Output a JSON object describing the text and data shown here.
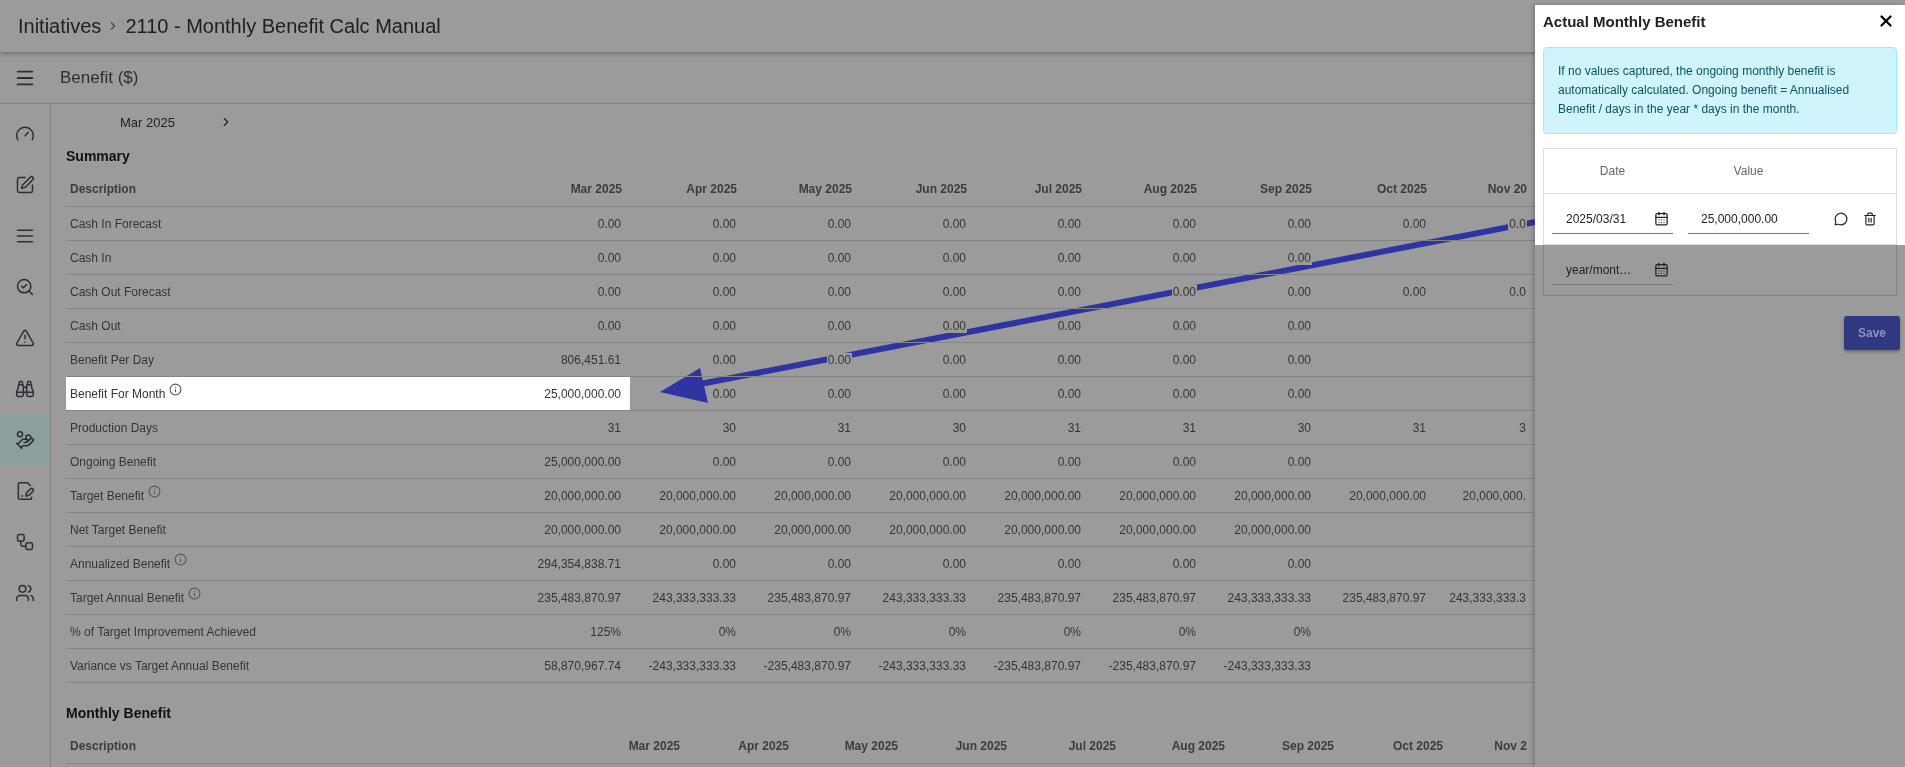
{
  "breadcrumb": {
    "root": "Initiatives",
    "title": "2110 - Monthly Benefit Calc Manual"
  },
  "page_title": "Benefit ($)",
  "sidebar": {
    "items": [
      {
        "kind": "gauge",
        "selected": false
      },
      {
        "kind": "edit",
        "selected": false
      },
      {
        "kind": "list",
        "selected": false
      },
      {
        "kind": "search",
        "selected": false
      },
      {
        "kind": "warning",
        "selected": false
      },
      {
        "kind": "binoculars",
        "selected": false
      },
      {
        "kind": "hand-coins",
        "selected": true
      },
      {
        "kind": "document",
        "selected": false
      },
      {
        "kind": "flow",
        "selected": false
      },
      {
        "kind": "people",
        "selected": false
      }
    ]
  },
  "period": {
    "label": "Mar 2025"
  },
  "summary": {
    "title": "Summary",
    "label_header": "Description",
    "columns": [
      "Mar 2025",
      "Apr 2025",
      "May 2025",
      "Jun 2025",
      "Jul 2025",
      "Aug 2025",
      "Sep 2025",
      "Oct 2025",
      "Nov 20"
    ],
    "rows": [
      {
        "label": "Cash In Forecast",
        "info": false,
        "highlighted": false,
        "cells": [
          "0.00",
          "0.00",
          "0.00",
          "0.00",
          "0.00",
          "0.00",
          "0.00",
          "0.00",
          "0.0"
        ]
      },
      {
        "label": "Cash In",
        "info": false,
        "highlighted": false,
        "cells": [
          "0.00",
          "0.00",
          "0.00",
          "0.00",
          "0.00",
          "0.00",
          "0.00",
          null,
          null
        ]
      },
      {
        "label": "Cash Out Forecast",
        "info": false,
        "highlighted": false,
        "cells": [
          "0.00",
          "0.00",
          "0.00",
          "0.00",
          "0.00",
          "0.00",
          "0.00",
          "0.00",
          "0.0"
        ]
      },
      {
        "label": "Cash Out",
        "info": false,
        "highlighted": false,
        "cells": [
          "0.00",
          "0.00",
          "0.00",
          "0.00",
          "0.00",
          "0.00",
          "0.00",
          null,
          null
        ]
      },
      {
        "label": "Benefit Per Day",
        "info": false,
        "highlighted": false,
        "cells": [
          "806,451.61",
          "0.00",
          "0.00",
          "0.00",
          "0.00",
          "0.00",
          "0.00",
          null,
          null
        ]
      },
      {
        "label": "Benefit For Month",
        "info": true,
        "highlighted": true,
        "cells": [
          "25,000,000.00",
          "0.00",
          "0.00",
          "0.00",
          "0.00",
          "0.00",
          "0.00",
          null,
          null
        ]
      },
      {
        "label": "Production Days",
        "info": false,
        "highlighted": false,
        "cells": [
          "31",
          "30",
          "31",
          "30",
          "31",
          "31",
          "30",
          "31",
          "3"
        ]
      },
      {
        "label": "Ongoing Benefit",
        "info": false,
        "highlighted": false,
        "cells": [
          "25,000,000.00",
          "0.00",
          "0.00",
          "0.00",
          "0.00",
          "0.00",
          "0.00",
          null,
          null
        ]
      },
      {
        "label": "Target Benefit",
        "info": true,
        "highlighted": false,
        "cells": [
          "20,000,000.00",
          "20,000,000.00",
          "20,000,000.00",
          "20,000,000.00",
          "20,000,000.00",
          "20,000,000.00",
          "20,000,000.00",
          "20,000,000.00",
          "20,000,000."
        ]
      },
      {
        "label": "Net Target Benefit",
        "info": false,
        "highlighted": false,
        "cells": [
          "20,000,000.00",
          "20,000,000.00",
          "20,000,000.00",
          "20,000,000.00",
          "20,000,000.00",
          "20,000,000.00",
          "20,000,000.00",
          null,
          null
        ]
      },
      {
        "label": "Annualized Benefit",
        "info": true,
        "highlighted": false,
        "cells": [
          "294,354,838.71",
          "0.00",
          "0.00",
          "0.00",
          "0.00",
          "0.00",
          "0.00",
          null,
          null
        ]
      },
      {
        "label": "Target Annual Benefit",
        "info": true,
        "highlighted": false,
        "cells": [
          "235,483,870.97",
          "243,333,333.33",
          "235,483,870.97",
          "243,333,333.33",
          "235,483,870.97",
          "235,483,870.97",
          "243,333,333.33",
          "235,483,870.97",
          "243,333,333.3"
        ]
      },
      {
        "label": "% of Target Improvement Achieved",
        "info": false,
        "highlighted": false,
        "cells": [
          "125%",
          "0%",
          "0%",
          "0%",
          "0%",
          "0%",
          "0%",
          null,
          null
        ]
      },
      {
        "label": "Variance vs Target Annual Benefit",
        "info": false,
        "highlighted": false,
        "cells": [
          "58,870,967.74",
          "-243,333,333.33",
          "-235,483,870.97",
          "-243,333,333.33",
          "-235,483,870.97",
          "-235,483,870.97",
          "-243,333,333.33",
          null,
          null
        ]
      }
    ]
  },
  "monthly": {
    "title": "Monthly Benefit",
    "label_header": "Description",
    "columns": [
      "Mar 2025",
      "Apr 2025",
      "May 2025",
      "Jun 2025",
      "Jul 2025",
      "Aug 2025",
      "Sep 2025",
      "Oct 2025",
      "Nov 2"
    ]
  },
  "drawer": {
    "title": "Actual Monthly Benefit",
    "spotlight": true,
    "note": "If no values captured, the ongoing monthly benefit is automatically calculated. Ongoing benefit = Annualised Benefit / days in the year * days in the month.",
    "columns": [
      "Date",
      "Value"
    ],
    "entries": [
      {
        "date": "2025/03/31",
        "value": "25,000,000.00",
        "highlighted": true
      },
      {
        "date_placeholder": "year/mont…",
        "highlighted": false
      }
    ],
    "save": "Save"
  }
}
